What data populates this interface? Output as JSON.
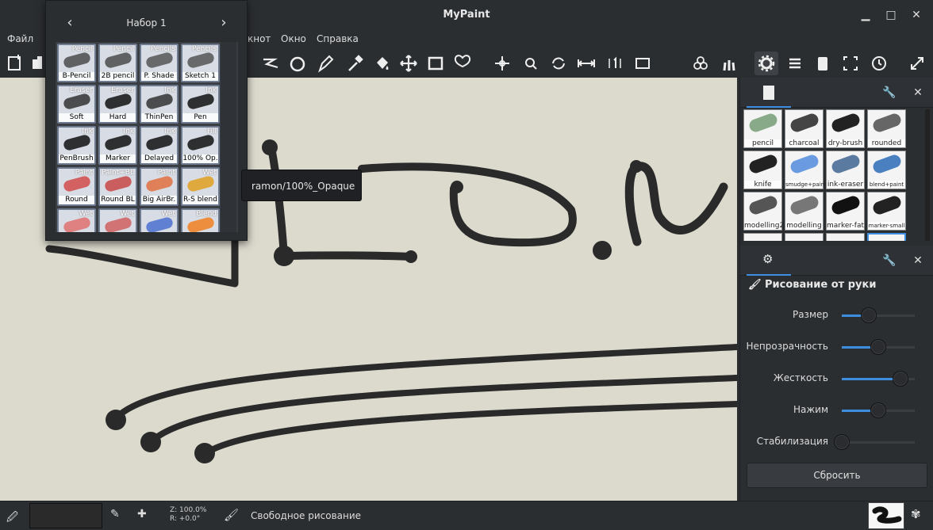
{
  "window": {
    "title": "MyPaint"
  },
  "menu": {
    "file": "Файл",
    "window_partial": "кнот",
    "view": "Окно",
    "help": "Справка"
  },
  "popup": {
    "title": "Набор 1",
    "brushes": [
      {
        "cat": "Pencil",
        "name": "B-Pencil"
      },
      {
        "cat": "Pencil",
        "name": "2B pencil"
      },
      {
        "cat": "Pencils",
        "name": "P. Shade"
      },
      {
        "cat": "Pencils",
        "name": "Sketch 1"
      },
      {
        "cat": "Eraser",
        "name": "Soft"
      },
      {
        "cat": "Eraser",
        "name": "Hard"
      },
      {
        "cat": "Ink",
        "name": "ThinPen"
      },
      {
        "cat": "Ink",
        "name": "Pen"
      },
      {
        "cat": "Ink",
        "name": "PenBrush"
      },
      {
        "cat": "Ink",
        "name": "Marker"
      },
      {
        "cat": "Ink",
        "name": "Delayed"
      },
      {
        "cat": "Fill",
        "name": "100% Op."
      },
      {
        "cat": "Paint",
        "name": "Round"
      },
      {
        "cat": "Paint+BL",
        "name": "Round BL"
      },
      {
        "cat": "Paint",
        "name": "Big AirBr."
      },
      {
        "cat": "Wet",
        "name": "R-S blend"
      },
      {
        "cat": "Wet",
        "name": ""
      },
      {
        "cat": "Wet",
        "name": ""
      },
      {
        "cat": "Wet",
        "name": ""
      },
      {
        "cat": "Blend",
        "name": ""
      }
    ]
  },
  "tooltip": {
    "text": "ramon/100%_Opaque"
  },
  "brush_panel": {
    "brushes": [
      "pencil",
      "charcoal",
      "dry-brush",
      "rounded",
      "knife",
      "smudge+paint",
      "ink-eraser",
      "blend+paint",
      "modelling2",
      "modelling",
      "marker-fat",
      "marker-small"
    ]
  },
  "tool_options": {
    "title": "Рисование от руки",
    "sliders": [
      {
        "label": "Размер",
        "value": 0.37
      },
      {
        "label": "Непрозрачность",
        "value": 0.5
      },
      {
        "label": "Жесткость",
        "value": 0.8
      },
      {
        "label": "Нажим",
        "value": 0.5
      },
      {
        "label": "Стабилизация",
        "value": 0.0
      }
    ],
    "reset_label": "Сбросить"
  },
  "status": {
    "zoom": "Z: 100.0%",
    "rotation": "R: +0.0°",
    "mode": "Свободное рисование"
  },
  "colors": {
    "accent": "#3d8ee0",
    "canvas": "#dcdacd",
    "stroke": "#2a2a2a"
  }
}
